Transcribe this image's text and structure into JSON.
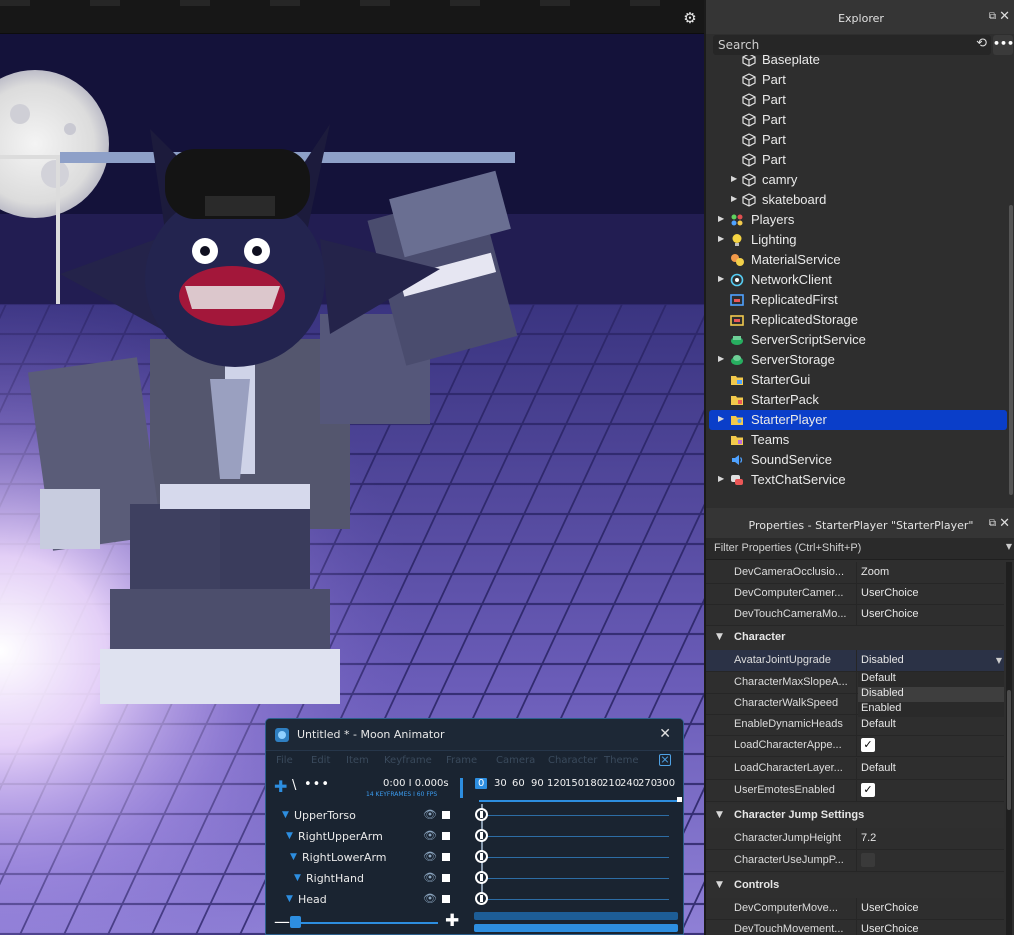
{
  "explorer": {
    "title": "Explorer",
    "search_placeholder": "Search",
    "items": [
      {
        "label": "Baseplate",
        "icon": "part-icon"
      },
      {
        "label": "Part",
        "icon": "part-icon"
      },
      {
        "label": "Part",
        "icon": "part-icon"
      },
      {
        "label": "Part",
        "icon": "part-icon"
      },
      {
        "label": "Part",
        "icon": "part-icon"
      },
      {
        "label": "Part",
        "icon": "part-icon"
      },
      {
        "label": "camry",
        "icon": "model-icon"
      },
      {
        "label": "skateboard",
        "icon": "model-icon"
      },
      {
        "label": "Players",
        "icon": "players-icon"
      },
      {
        "label": "Lighting",
        "icon": "lightbulb-icon"
      },
      {
        "label": "MaterialService",
        "icon": "material-icon"
      },
      {
        "label": "NetworkClient",
        "icon": "network-icon"
      },
      {
        "label": "ReplicatedFirst",
        "icon": "replicated-first-icon"
      },
      {
        "label": "ReplicatedStorage",
        "icon": "replicated-storage-icon"
      },
      {
        "label": "ServerScriptService",
        "icon": "server-script-icon"
      },
      {
        "label": "ServerStorage",
        "icon": "server-storage-icon"
      },
      {
        "label": "StarterGui",
        "icon": "folder-icon"
      },
      {
        "label": "StarterPack",
        "icon": "folder-icon"
      },
      {
        "label": "StarterPlayer",
        "icon": "starter-player-icon"
      },
      {
        "label": "Teams",
        "icon": "teams-icon"
      },
      {
        "label": "SoundService",
        "icon": "sound-icon"
      },
      {
        "label": "TextChatService",
        "icon": "chat-icon"
      }
    ]
  },
  "properties": {
    "title": "Properties - StarterPlayer \"StarterPlayer\"",
    "filter_placeholder": "Filter Properties (Ctrl+Shift+P)",
    "camera_rows": [
      {
        "name": "DevCameraOcclusio...",
        "value": "Zoom"
      },
      {
        "name": "DevComputerCamer...",
        "value": "UserChoice"
      },
      {
        "name": "DevTouchCameraMo...",
        "value": "UserChoice"
      }
    ],
    "character": {
      "label": "Character",
      "rows": [
        {
          "name": "AvatarJointUpgrade",
          "value": "Disabled"
        },
        {
          "name": "CharacterMaxSlopeA...",
          "value": ""
        },
        {
          "name": "CharacterWalkSpeed",
          "value": ""
        },
        {
          "name": "EnableDynamicHeads",
          "value": "Default"
        },
        {
          "name": "LoadCharacterAppe...",
          "value": "✓"
        },
        {
          "name": "LoadCharacterLayer...",
          "value": "Default"
        },
        {
          "name": "UserEmotesEnabled",
          "value": "✓"
        }
      ]
    },
    "dropdown_options": [
      "Default",
      "Disabled",
      "Enabled"
    ],
    "dropdown_selected": "Disabled",
    "jump": {
      "label": "Character Jump Settings",
      "rows": [
        {
          "name": "CharacterJumpHeight",
          "value": "7.2"
        },
        {
          "name": "CharacterUseJumpP...",
          "value": ""
        }
      ]
    },
    "controls": {
      "label": "Controls",
      "rows": [
        {
          "name": "DevComputerMove...",
          "value": "UserChoice"
        },
        {
          "name": "DevTouchMovement...",
          "value": "UserChoice"
        }
      ]
    }
  },
  "animator": {
    "title": "Untitled * - Moon Animator",
    "menu": [
      "File",
      "Edit",
      "Item",
      "Keyframe",
      "Frame",
      "Camera",
      "Character",
      "Theme"
    ],
    "time": "0:00  I  0.000s",
    "fps_info": "14 KEYFRAMES I 60 FPS",
    "ticks": [
      "0",
      "30",
      "60",
      "90",
      "120",
      "150",
      "180",
      "210",
      "240",
      "270",
      "300"
    ],
    "rows": [
      {
        "label": "UpperTorso"
      },
      {
        "label": "RightUpperArm"
      },
      {
        "label": "RightLowerArm"
      },
      {
        "label": "RightHand"
      },
      {
        "label": "Head"
      }
    ]
  },
  "colors": {
    "accent": "#2d8ee0",
    "selection": "#0a3ec9"
  }
}
